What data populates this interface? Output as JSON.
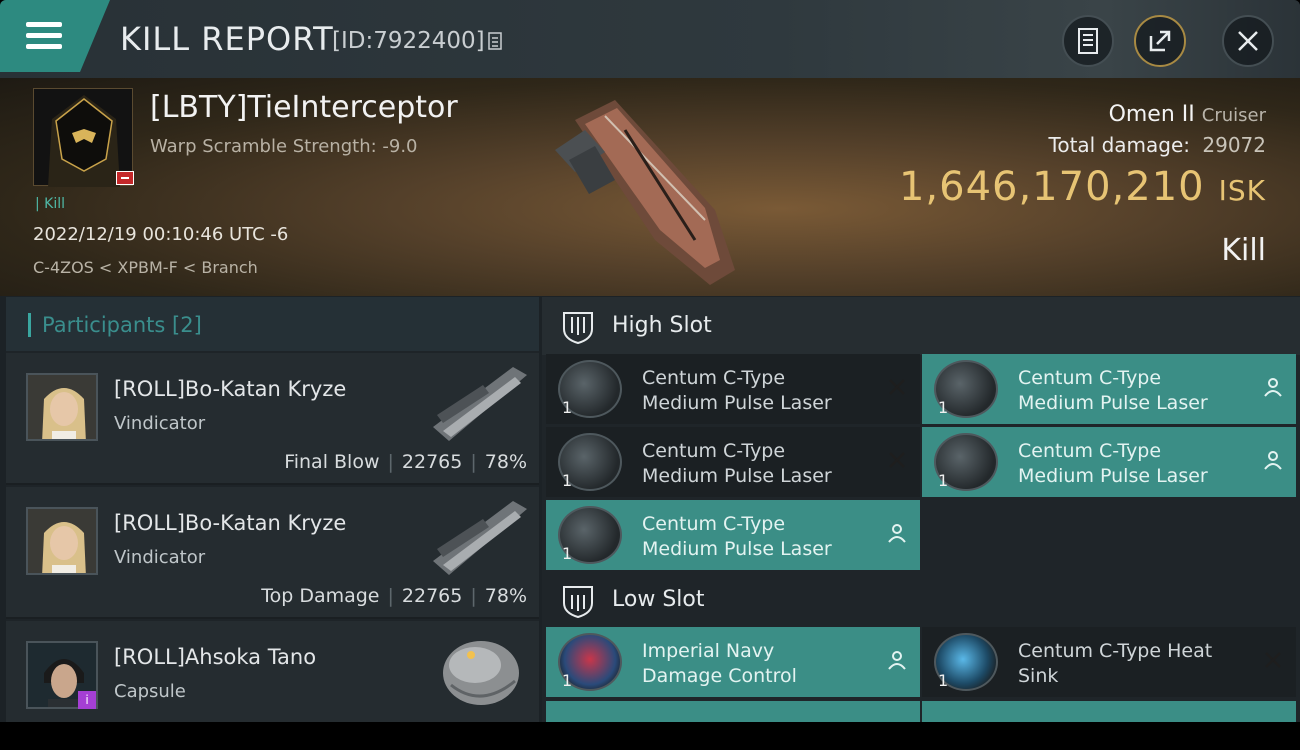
{
  "header": {
    "title": "KILL REPORT",
    "report_id": "[ID:7922400]",
    "icons": [
      "menu-icon",
      "document-icon",
      "share-icon",
      "close-icon"
    ]
  },
  "victim": {
    "name": "[LBTY]TieInterceptor",
    "warp_scramble": "Warp Scramble Strength: -9.0",
    "kill_tag": "| Kill",
    "date": "2022/12/19 00:10:46 UTC -6",
    "location": "C-4ZOS < XPBM-F < Branch",
    "ship": "Omen II",
    "ship_class": "Cruiser",
    "damage_label": "Total damage:",
    "damage_value": "29072",
    "isk_value": "1,646,170,210",
    "isk_unit": "ISK",
    "result": "Kill"
  },
  "participants": {
    "title": "Participants",
    "count": "[2]",
    "rows": [
      {
        "name": "[ROLL]Bo-Katan Kryze",
        "ship": "Vindicator",
        "role": "Final Blow",
        "damage": "22765",
        "percent": "78%"
      },
      {
        "name": "[ROLL]Bo-Katan Kryze",
        "ship": "Vindicator",
        "role": "Top Damage",
        "damage": "22765",
        "percent": "78%"
      },
      {
        "name": "[ROLL]Ahsoka Tano",
        "ship": "Capsule"
      }
    ]
  },
  "fitting": {
    "high_slot": {
      "title": "High Slot",
      "modules": [
        {
          "line1": "Centum C-Type",
          "line2": "Medium Pulse Laser",
          "qty": "1",
          "status": "destroyed"
        },
        {
          "line1": "Centum C-Type",
          "line2": "Medium Pulse Laser",
          "qty": "1",
          "status": "dropped"
        },
        {
          "line1": "Centum C-Type",
          "line2": "Medium Pulse Laser",
          "qty": "1",
          "status": "destroyed"
        },
        {
          "line1": "Centum C-Type",
          "line2": "Medium Pulse Laser",
          "qty": "1",
          "status": "dropped"
        },
        {
          "line1": "Centum C-Type",
          "line2": "Medium Pulse Laser",
          "qty": "1",
          "status": "dropped"
        }
      ]
    },
    "low_slot": {
      "title": "Low Slot",
      "modules": [
        {
          "line1": "Imperial Navy",
          "line2": "Damage Control",
          "qty": "1",
          "status": "dropped"
        },
        {
          "line1": "Centum C-Type Heat",
          "line2": "Sink",
          "qty": "1",
          "status": "destroyed"
        }
      ]
    }
  },
  "colors": {
    "accent_teal": "#3b8e86",
    "isk_gold": "#e7c474",
    "destroyed_bg": "#1b2023",
    "dropped_bg": "#3b8e86"
  }
}
